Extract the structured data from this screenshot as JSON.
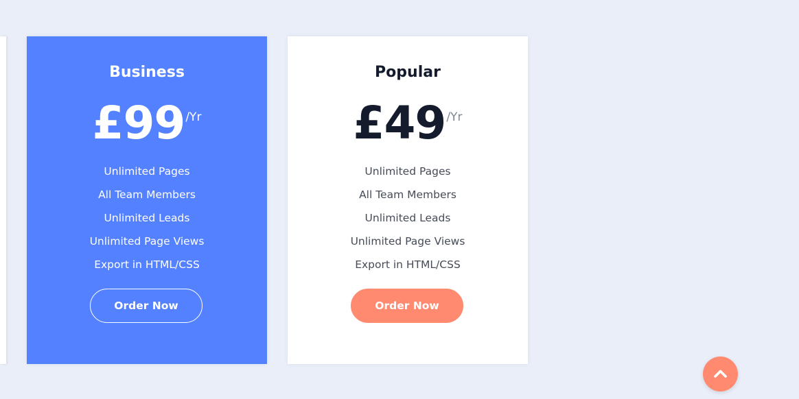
{
  "pricing": {
    "plans": [
      {
        "title": "Business",
        "price": "£99",
        "period": "/Yr",
        "features": [
          "Unlimited Pages",
          "All Team Members",
          "Unlimited Leads",
          "Unlimited Page Views",
          "Export in HTML/CSS"
        ],
        "button_label": "Order Now"
      },
      {
        "title": "Popular",
        "price": "£49",
        "period": "/Yr",
        "features": [
          "Unlimited Pages",
          "All Team Members",
          "Unlimited Leads",
          "Unlimited Page Views",
          "Export in HTML/CSS"
        ],
        "button_label": "Order Now"
      }
    ]
  },
  "colors": {
    "page_background": "#e9eef8",
    "business_card": "#5481ff",
    "popular_card": "#ffffff",
    "accent": "#ff8a70",
    "dark_text": "#141b2d"
  },
  "scroll_top": {
    "icon": "chevron-up-icon"
  }
}
